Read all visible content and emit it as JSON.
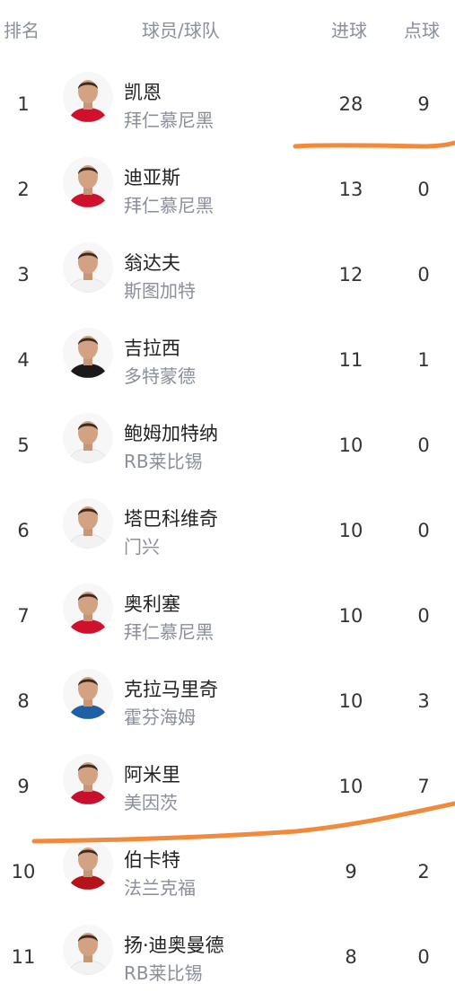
{
  "header": {
    "rank": "排名",
    "player": "球员/球队",
    "goals": "进球",
    "penalties": "点球"
  },
  "rows": [
    {
      "rank": "1",
      "name": "凯恩",
      "team": "拜仁慕尼黑",
      "goals": "28",
      "penalties": "9",
      "kit": "#d0112b"
    },
    {
      "rank": "2",
      "name": "迪亚斯",
      "team": "拜仁慕尼黑",
      "goals": "13",
      "penalties": "0",
      "kit": "#d0112b"
    },
    {
      "rank": "3",
      "name": "翁达夫",
      "team": "斯图加特",
      "goals": "12",
      "penalties": "0",
      "kit": "#f2f2f2"
    },
    {
      "rank": "4",
      "name": "吉拉西",
      "team": "多特蒙德",
      "goals": "11",
      "penalties": "1",
      "kit": "#1a1a1a"
    },
    {
      "rank": "5",
      "name": "鲍姆加特纳",
      "team": "RB莱比锡",
      "goals": "10",
      "penalties": "0",
      "kit": "#f2f2f2"
    },
    {
      "rank": "6",
      "name": "塔巴科维奇",
      "team": "门兴",
      "goals": "10",
      "penalties": "0",
      "kit": "#f2f2f2"
    },
    {
      "rank": "7",
      "name": "奥利塞",
      "team": "拜仁慕尼黑",
      "goals": "10",
      "penalties": "0",
      "kit": "#d0112b"
    },
    {
      "rank": "8",
      "name": "克拉马里奇",
      "team": "霍芬海姆",
      "goals": "10",
      "penalties": "3",
      "kit": "#1f5fa8"
    },
    {
      "rank": "9",
      "name": "阿米里",
      "team": "美因茨",
      "goals": "10",
      "penalties": "7",
      "kit": "#c8102e"
    },
    {
      "rank": "10",
      "name": "伯卡特",
      "team": "法兰克福",
      "goals": "9",
      "penalties": "2",
      "kit": "#b5121b"
    },
    {
      "rank": "11",
      "name": "扬·迪奥曼德",
      "team": "RB莱比锡",
      "goals": "8",
      "penalties": "0",
      "kit": "#f2f2f2"
    }
  ],
  "colors": {
    "marker": "#f08a3c",
    "header_text": "#8a8f99",
    "team_text": "#8a8f99"
  }
}
